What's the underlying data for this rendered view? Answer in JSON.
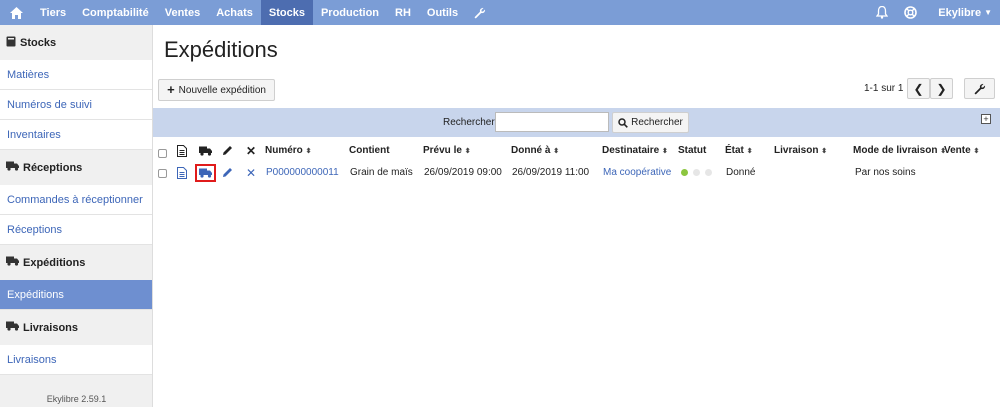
{
  "topnav": {
    "items": [
      "Tiers",
      "Comptabilité",
      "Ventes",
      "Achats",
      "Stocks",
      "Production",
      "RH",
      "Outils"
    ],
    "active": "Stocks",
    "user": "Ekylibre"
  },
  "sidebar": {
    "sections": [
      {
        "title": "Stocks",
        "items": [
          "Matières",
          "Numéros de suivi",
          "Inventaires"
        ]
      },
      {
        "title": "Réceptions",
        "items": [
          "Commandes à réceptionner",
          "Réceptions"
        ]
      },
      {
        "title": "Expéditions",
        "items": [
          "Expéditions"
        ]
      },
      {
        "title": "Livraisons",
        "items": [
          "Livraisons"
        ]
      }
    ],
    "active_item": "Expéditions",
    "version": "Ekylibre 2.59.1"
  },
  "page": {
    "title": "Expéditions",
    "new_button": "Nouvelle expédition",
    "pager_text": "1-1 sur 1"
  },
  "search": {
    "label": "Rechercher",
    "value": "",
    "button": "Rechercher"
  },
  "table": {
    "headers": {
      "number": "Numéro",
      "contents": "Contient",
      "planned": "Prévu le",
      "given": "Donné à",
      "recipient": "Destinataire",
      "status": "Statut",
      "state": "État",
      "delivery": "Livraison",
      "delivery_mode": "Mode de livraison",
      "sale": "Vente"
    },
    "rows": [
      {
        "number": "P000000000011",
        "contents": "Grain de maïs",
        "planned": "26/09/2019 09:00",
        "given": "26/09/2019 11:00",
        "recipient": "Ma coopérative",
        "status_color": "#8cc63f",
        "state": "Donné",
        "delivery": "",
        "delivery_mode": "Par nos soins",
        "sale": ""
      }
    ]
  },
  "colors": {
    "nav": "#7b9dd6",
    "nav_active": "#4d6db0",
    "link": "#3d66b8",
    "search_bar": "#c8d5ec",
    "highlight": "#e01b1b"
  }
}
